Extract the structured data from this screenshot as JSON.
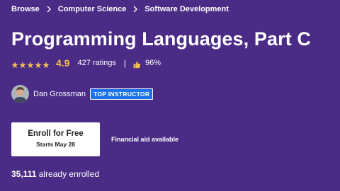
{
  "breadcrumb": {
    "items": [
      "Browse",
      "Computer Science",
      "Software Development"
    ]
  },
  "course": {
    "title": "Programming Languages, Part C"
  },
  "ratings": {
    "stars": 5,
    "value": "4.9",
    "count": "427 ratings",
    "separator": "|",
    "approval": "96%"
  },
  "instructor": {
    "name": "Dan Grossman",
    "badge": "TOP INSTRUCTOR"
  },
  "enroll": {
    "label": "Enroll for Free",
    "sub": "Starts May 28"
  },
  "financial_aid": "Financial aid available",
  "enrolled": {
    "count": "35,111",
    "suffix": " already enrolled"
  },
  "colors": {
    "background": "#4a2b86",
    "star": "#f5c04a",
    "badge": "#1a73e8",
    "button": "#ffffff"
  }
}
